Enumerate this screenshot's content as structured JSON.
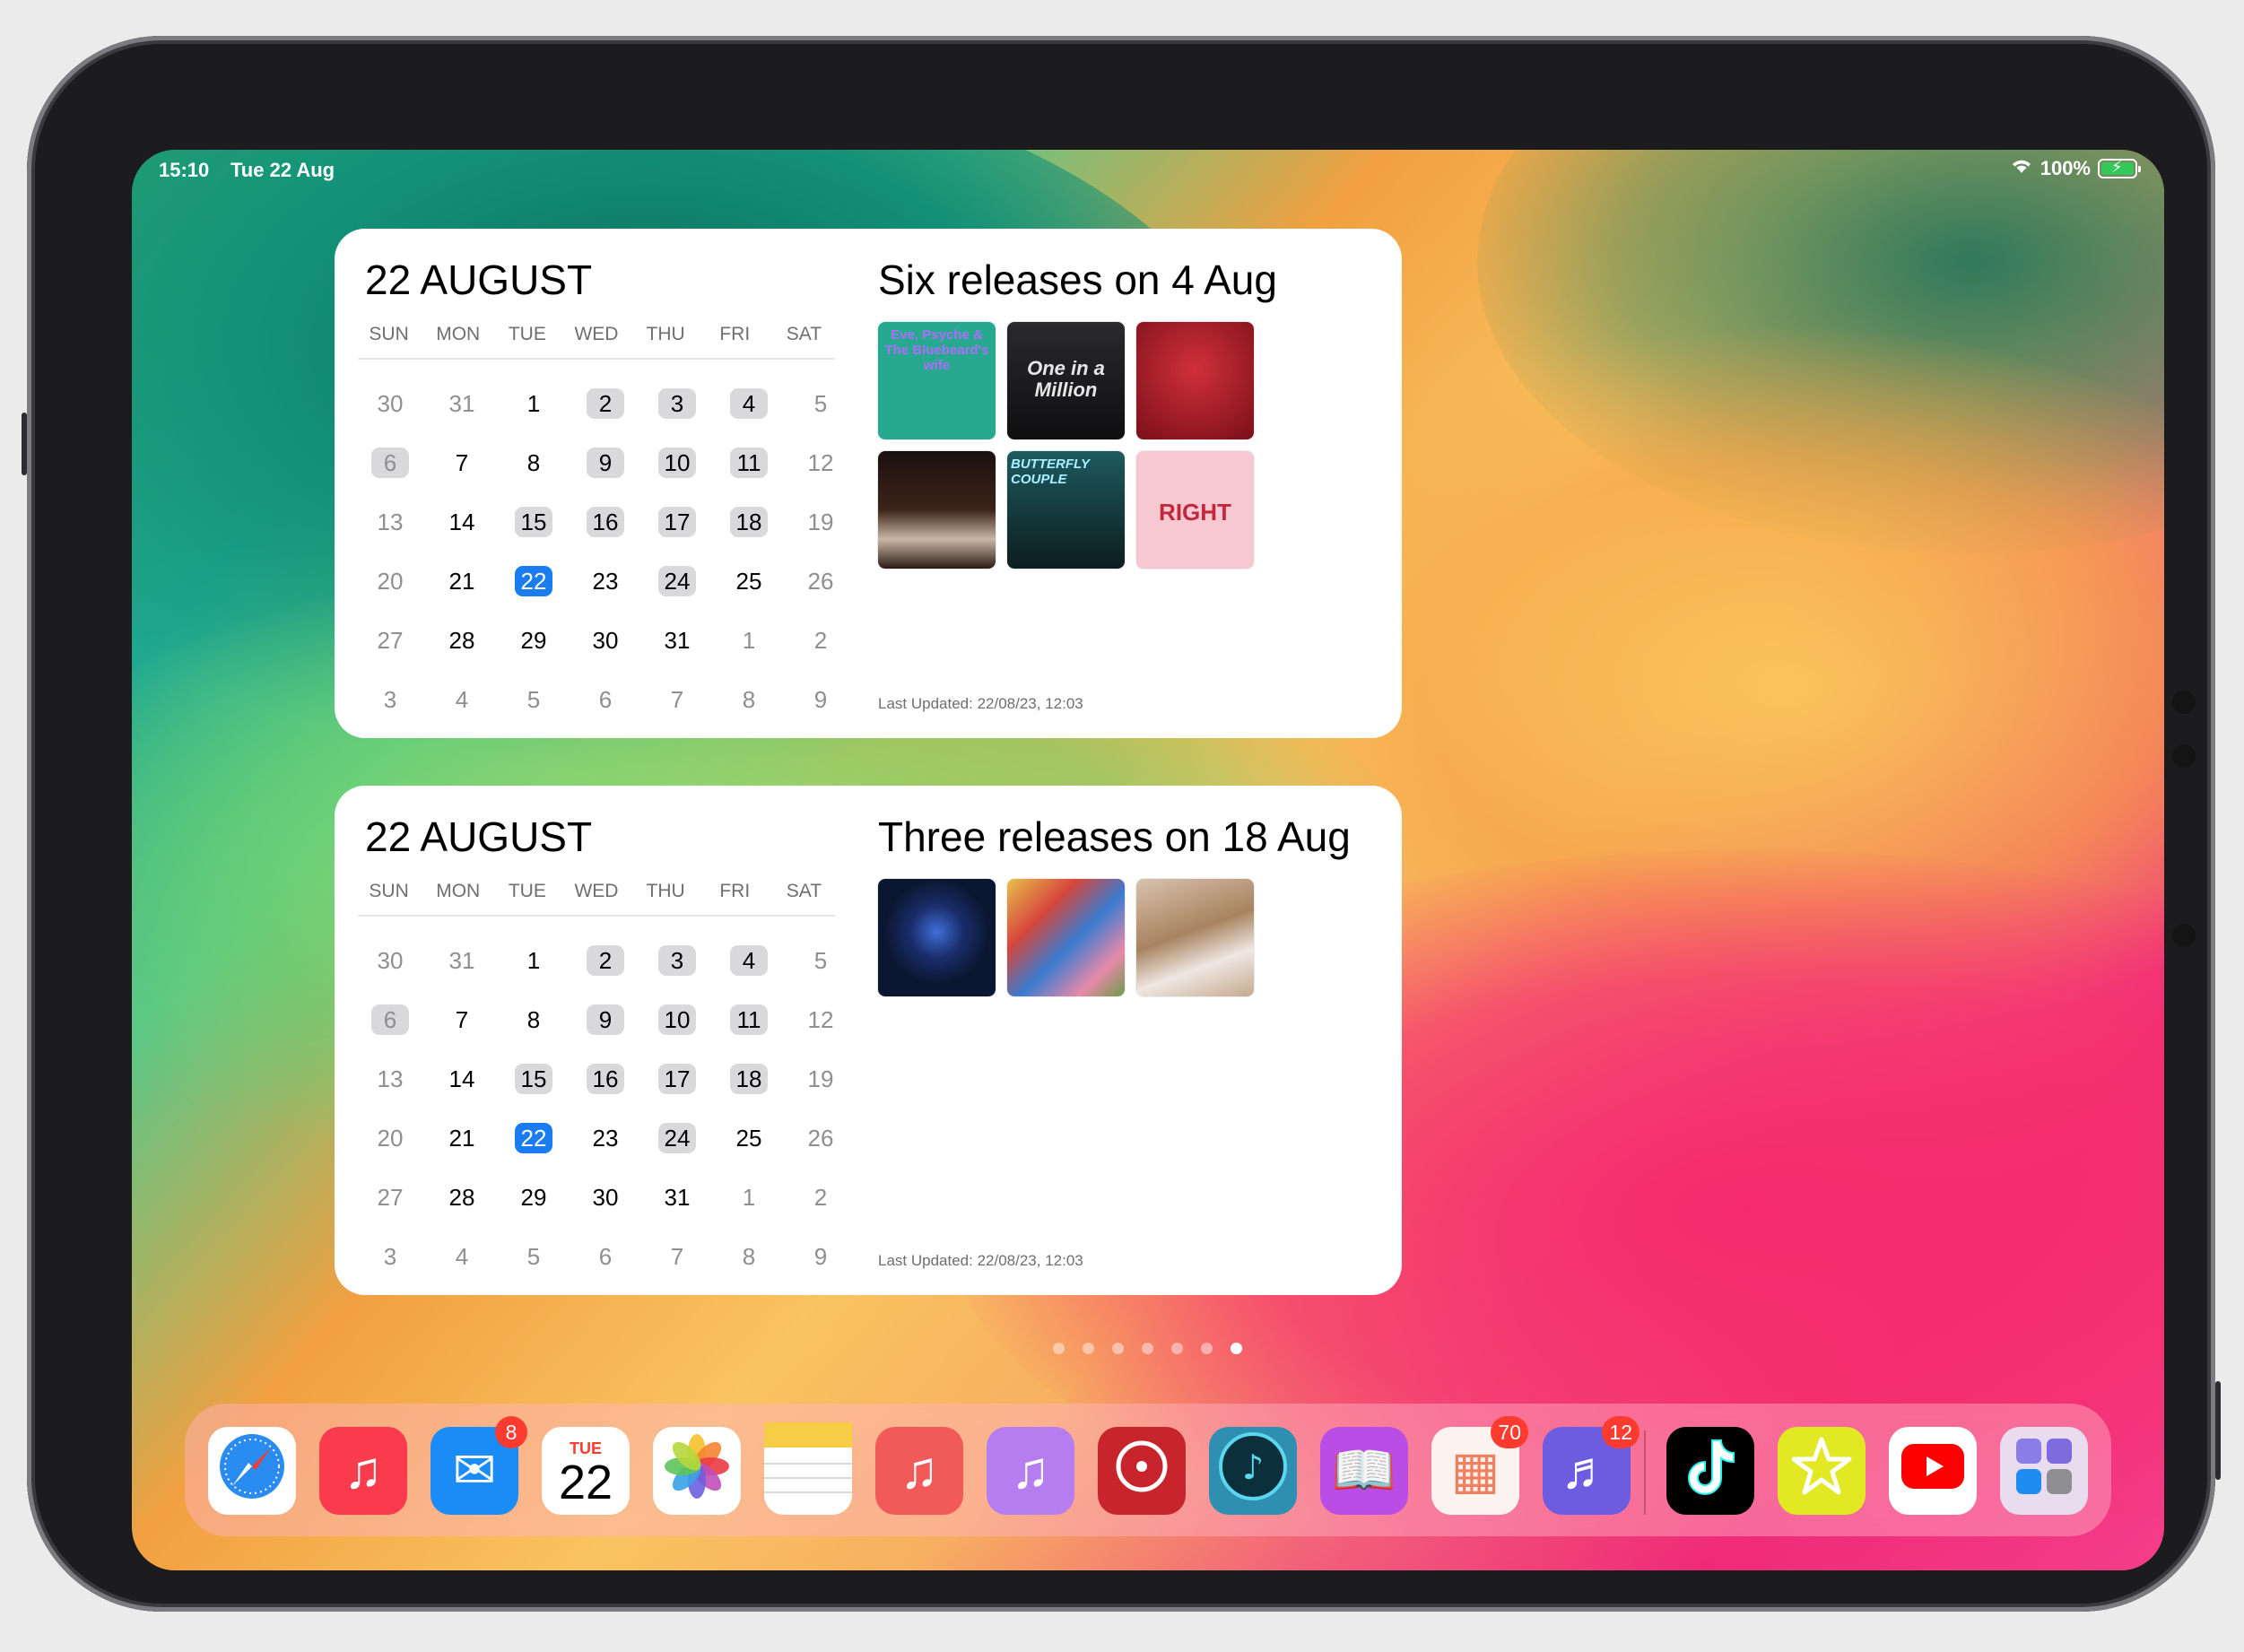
{
  "status_bar": {
    "time": "15:10",
    "date": "Tue 22 Aug",
    "battery": "100%"
  },
  "widgets": [
    {
      "calendar_title": "22 AUGUST",
      "weekdays": [
        "SUN",
        "MON",
        "TUE",
        "WED",
        "THU",
        "FRI",
        "SAT"
      ],
      "weeks": [
        [
          "30",
          "31",
          "1",
          "2",
          "3",
          "4",
          "5"
        ],
        [
          "6",
          "7",
          "8",
          "9",
          "10",
          "11",
          "12"
        ],
        [
          "13",
          "14",
          "15",
          "16",
          "17",
          "18",
          "19"
        ],
        [
          "20",
          "21",
          "22",
          "23",
          "24",
          "25",
          "26"
        ],
        [
          "27",
          "28",
          "29",
          "30",
          "31",
          "1",
          "2"
        ],
        [
          "3",
          "4",
          "5",
          "6",
          "7",
          "8",
          "9"
        ]
      ],
      "releases_title": "Six releases on 4 Aug",
      "covers": [
        {
          "name": "cover-eve-psyche",
          "text": "Eve, Psyche & The Bluebeard's wife",
          "bg": "#27a98f",
          "fg": "#b16bff"
        },
        {
          "name": "cover-one-in-a-million",
          "text": "One in a Million",
          "bg": "#1a1a1c",
          "fg": "#e6e6e6"
        },
        {
          "name": "cover-red",
          "text": "",
          "bg": "#9b1a22",
          "fg": "#ffffff"
        },
        {
          "name": "cover-car-night",
          "text": "",
          "bg": "#3a2418",
          "fg": "#ffffff"
        },
        {
          "name": "cover-butterfly-couple",
          "text": "BUTTERFLY COUPLE",
          "bg": "#1d4b4e",
          "fg": "#a8f0ff"
        },
        {
          "name": "cover-pink-right",
          "text": "RIGHT",
          "bg": "#f6c9d2",
          "fg": "#c2283c"
        }
      ],
      "last_updated": "Last Updated: 22/08/23, 12:03"
    },
    {
      "calendar_title": "22 AUGUST",
      "weekdays": [
        "SUN",
        "MON",
        "TUE",
        "WED",
        "THU",
        "FRI",
        "SAT"
      ],
      "weeks": [
        [
          "30",
          "31",
          "1",
          "2",
          "3",
          "4",
          "5"
        ],
        [
          "6",
          "7",
          "8",
          "9",
          "10",
          "11",
          "12"
        ],
        [
          "13",
          "14",
          "15",
          "16",
          "17",
          "18",
          "19"
        ],
        [
          "20",
          "21",
          "22",
          "23",
          "24",
          "25",
          "26"
        ],
        [
          "27",
          "28",
          "29",
          "30",
          "31",
          "1",
          "2"
        ],
        [
          "3",
          "4",
          "5",
          "6",
          "7",
          "8",
          "9"
        ]
      ],
      "releases_title": "Three releases on 18 Aug",
      "covers": [
        {
          "name": "cover-blue-heart",
          "text": "",
          "bg": "#0b1730",
          "fg": "#6ea6ff"
        },
        {
          "name": "cover-collage",
          "text": "",
          "bg": "#b8443c",
          "fg": "#ffffff"
        },
        {
          "name": "cover-portrait",
          "text": "",
          "bg": "#c9b09a",
          "fg": "#ffffff"
        }
      ],
      "last_updated": "Last Updated: 22/08/23, 12:03"
    }
  ],
  "calendar_styles": {
    "highlighted_days_week_index": [
      [
        3,
        4,
        5
      ],
      [
        0,
        3,
        4,
        5
      ],
      [
        2,
        3,
        4,
        5
      ],
      [
        4
      ],
      [],
      []
    ],
    "today": {
      "week": 3,
      "day": 2
    }
  },
  "page_dots": {
    "count": 7,
    "active": 6
  },
  "dock": {
    "apps": [
      {
        "name": "safari",
        "icon": "safari-icon",
        "glyph": "🧭",
        "bg": "#ffffff",
        "badge": ""
      },
      {
        "name": "music",
        "icon": "music-icon",
        "glyph": "♫",
        "bg": "#fa3b4e",
        "badge": ""
      },
      {
        "name": "mail",
        "icon": "mail-icon",
        "glyph": "✉",
        "bg": "#1b8bf5",
        "badge": "8"
      },
      {
        "name": "calendar",
        "icon": "calendar-icon",
        "glyph": "22",
        "bg": "#ffffff",
        "badge": "",
        "day": "TUE"
      },
      {
        "name": "photos",
        "icon": "photos-icon",
        "glyph": "✿",
        "bg": "#ffffff",
        "badge": ""
      },
      {
        "name": "notes",
        "icon": "notes-icon",
        "glyph": "",
        "bg": "#ffffff",
        "badge": ""
      },
      {
        "name": "music-alt",
        "icon": "music-note-icon",
        "glyph": "♫",
        "bg": "#f25a5a",
        "badge": ""
      },
      {
        "name": "itunes",
        "icon": "itunes-icon",
        "glyph": "♫",
        "bg": "#b57df0",
        "badge": ""
      },
      {
        "name": "record",
        "icon": "vinyl-icon",
        "glyph": "◉",
        "bg": "#c8242c",
        "badge": ""
      },
      {
        "name": "guitar",
        "icon": "guitar-icon",
        "glyph": "♪",
        "bg": "#2f8fb0",
        "badge": ""
      },
      {
        "name": "audiobooks",
        "icon": "audiobook-icon",
        "glyph": "📖",
        "bg": "#b94de6",
        "badge": ""
      },
      {
        "name": "planner",
        "icon": "planner-icon",
        "glyph": "▦",
        "bg": "#fdf3ee",
        "badge": "70"
      },
      {
        "name": "music-box",
        "icon": "music-box-icon",
        "glyph": "♬",
        "bg": "#6d5ce0",
        "badge": "12"
      },
      {
        "name": "tiktok",
        "icon": "tiktok-icon",
        "glyph": "♪",
        "bg": "#000000",
        "badge": ""
      },
      {
        "name": "stars",
        "icon": "star-icon",
        "glyph": "☆",
        "bg": "#e2e823",
        "badge": ""
      },
      {
        "name": "youtube",
        "icon": "youtube-icon",
        "glyph": "▶",
        "bg": "#ffffff",
        "badge": ""
      },
      {
        "name": "app-folder",
        "icon": "folder-icon",
        "glyph": "▦",
        "bg": "#e9dcef",
        "badge": ""
      }
    ]
  }
}
